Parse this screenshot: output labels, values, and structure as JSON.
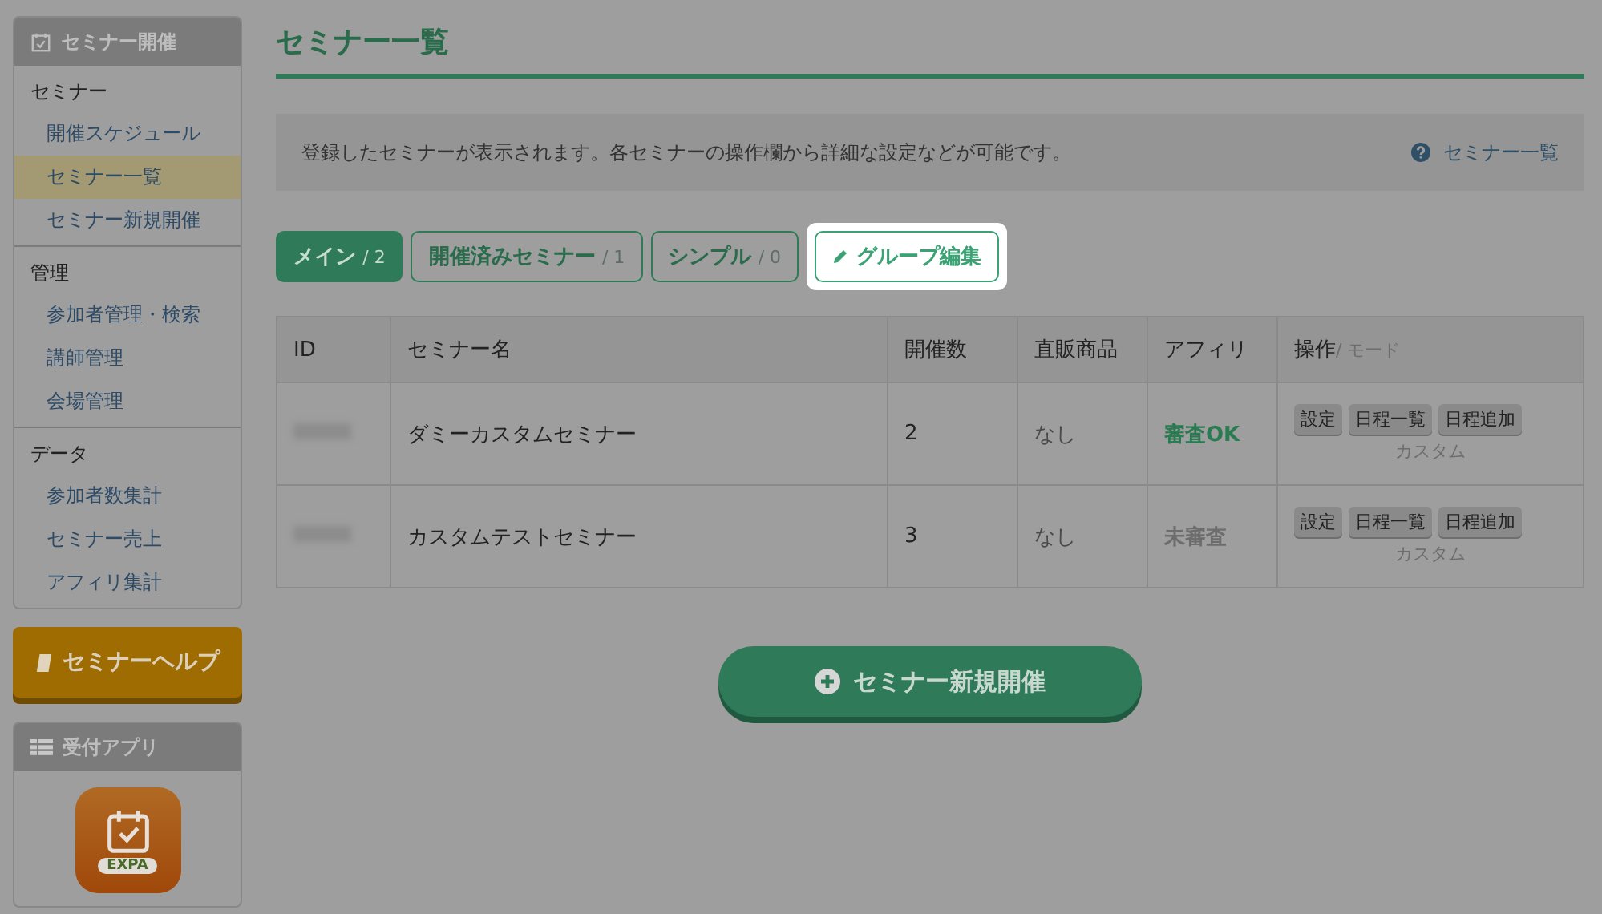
{
  "sidebar": {
    "title": "セミナー開催",
    "sections": [
      {
        "heading": "セミナー",
        "items": [
          {
            "label": "開催スケジュール",
            "selected": false
          },
          {
            "label": "セミナー一覧",
            "selected": true
          },
          {
            "label": "セミナー新規開催",
            "selected": false
          }
        ]
      },
      {
        "heading": "管理",
        "items": [
          {
            "label": "参加者管理・検索",
            "selected": false
          },
          {
            "label": "講師管理",
            "selected": false
          },
          {
            "label": "会場管理",
            "selected": false
          }
        ]
      },
      {
        "heading": "データ",
        "items": [
          {
            "label": "参加者数集計",
            "selected": false
          },
          {
            "label": "セミナー売上",
            "selected": false
          },
          {
            "label": "アフィリ集計",
            "selected": false
          }
        ]
      }
    ],
    "help_button": "セミナーヘルプ",
    "app_panel": {
      "title": "受付アプリ",
      "app_label": "EXPA"
    }
  },
  "page": {
    "title": "セミナー一覧",
    "info": "登録したセミナーが表示されます。各セミナーの操作欄から詳細な設定などが可能です。",
    "help_link": "セミナー一覧"
  },
  "tabs": [
    {
      "label": "メイン",
      "count": "/ 2",
      "selected": true
    },
    {
      "label": "開催済みセミナー",
      "count": "/ 1",
      "selected": false
    },
    {
      "label": "シンプル",
      "count": "/ 0",
      "selected": false
    }
  ],
  "group_edit_button": "グループ編集",
  "table": {
    "columns": [
      "ID",
      "セミナー名",
      "開催数",
      "直販商品",
      "アフィリ",
      "操作"
    ],
    "columns_sub": "/ モード",
    "rows": [
      {
        "name": "ダミーカスタムセミナー",
        "count": "2",
        "direct": "なし",
        "affiliate": "審査OK",
        "affiliate_approved": true,
        "actions": [
          "設定",
          "日程一覧",
          "日程追加"
        ],
        "mode": "カスタム"
      },
      {
        "name": "カスタムテストセミナー",
        "count": "3",
        "direct": "なし",
        "affiliate": "未審査",
        "affiliate_approved": false,
        "actions": [
          "設定",
          "日程一覧",
          "日程追加"
        ],
        "mode": "カスタム"
      }
    ]
  },
  "new_button": "セミナー新規開催"
}
